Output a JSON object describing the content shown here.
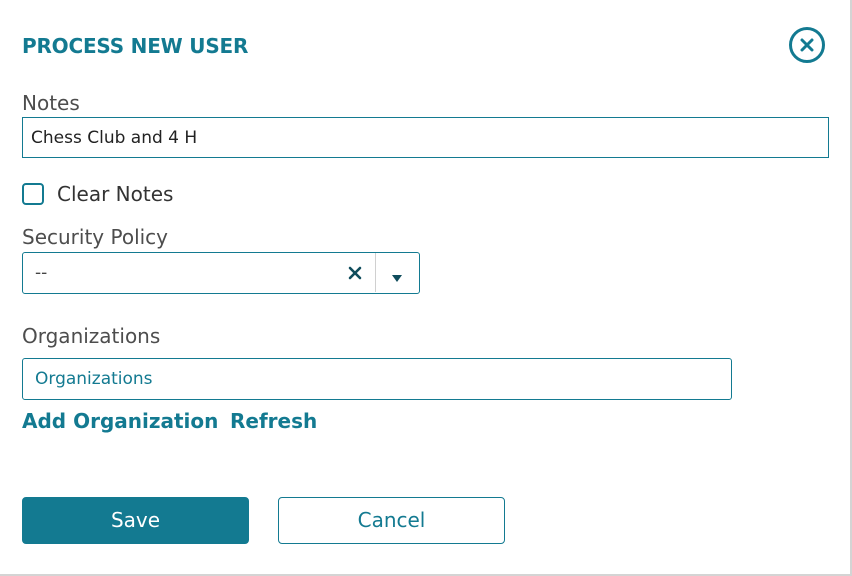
{
  "dialog": {
    "title": "PROCESS NEW USER"
  },
  "notes": {
    "label": "Notes",
    "value": "Chess Club and 4 H"
  },
  "clear_notes": {
    "label": "Clear Notes",
    "checked": false
  },
  "security_policy": {
    "label": "Security Policy",
    "selected": "--"
  },
  "organizations": {
    "label": "Organizations",
    "placeholder": "Organizations",
    "add_link": "Add Organization",
    "refresh_link": "Refresh"
  },
  "actions": {
    "save_label": "Save",
    "cancel_label": "Cancel"
  },
  "colors": {
    "accent": "#137a91",
    "label_text": "#4d4d4d"
  },
  "icons": {
    "close": "close-circle-icon",
    "select_clear": "x-icon",
    "select_dropdown": "caret-down-icon"
  }
}
